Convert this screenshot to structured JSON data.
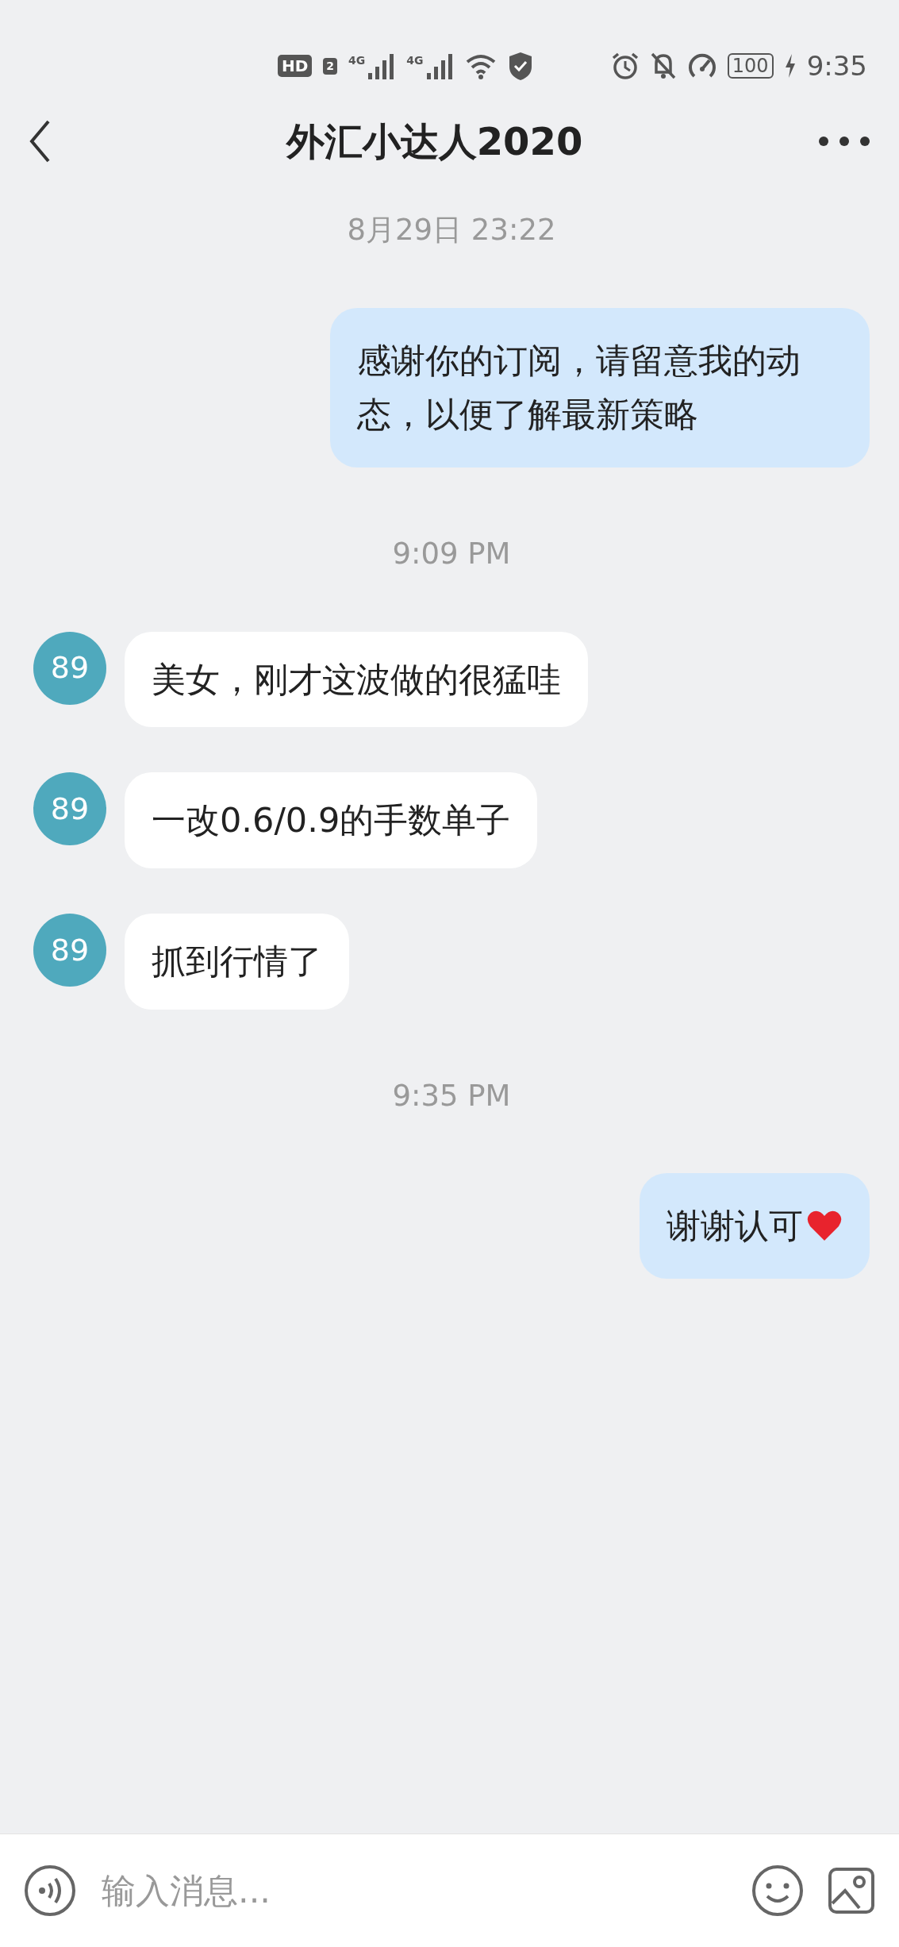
{
  "status_bar": {
    "hd": "HD",
    "sim": "2",
    "networks": [
      "4G",
      "4G"
    ],
    "battery": "100",
    "time": "9:35"
  },
  "header": {
    "title": "外汇小达人2020"
  },
  "messages": [
    {
      "kind": "timestamp",
      "text": "8月29日 23:22"
    },
    {
      "kind": "outgoing",
      "text": "感谢你的订阅，请留意我的动态，以便了解最新策略",
      "heart": false
    },
    {
      "kind": "timestamp",
      "text": "9:09 PM"
    },
    {
      "kind": "incoming",
      "avatar": "89",
      "text": "美女，刚才这波做的很猛哇"
    },
    {
      "kind": "incoming",
      "avatar": "89",
      "text": "一改0.6/0.9的手数单子"
    },
    {
      "kind": "incoming",
      "avatar": "89",
      "text": "抓到行情了"
    },
    {
      "kind": "timestamp",
      "text": "9:35 PM"
    },
    {
      "kind": "outgoing",
      "text": "谢谢认可",
      "heart": true
    }
  ],
  "composer": {
    "placeholder": "输入消息..."
  }
}
